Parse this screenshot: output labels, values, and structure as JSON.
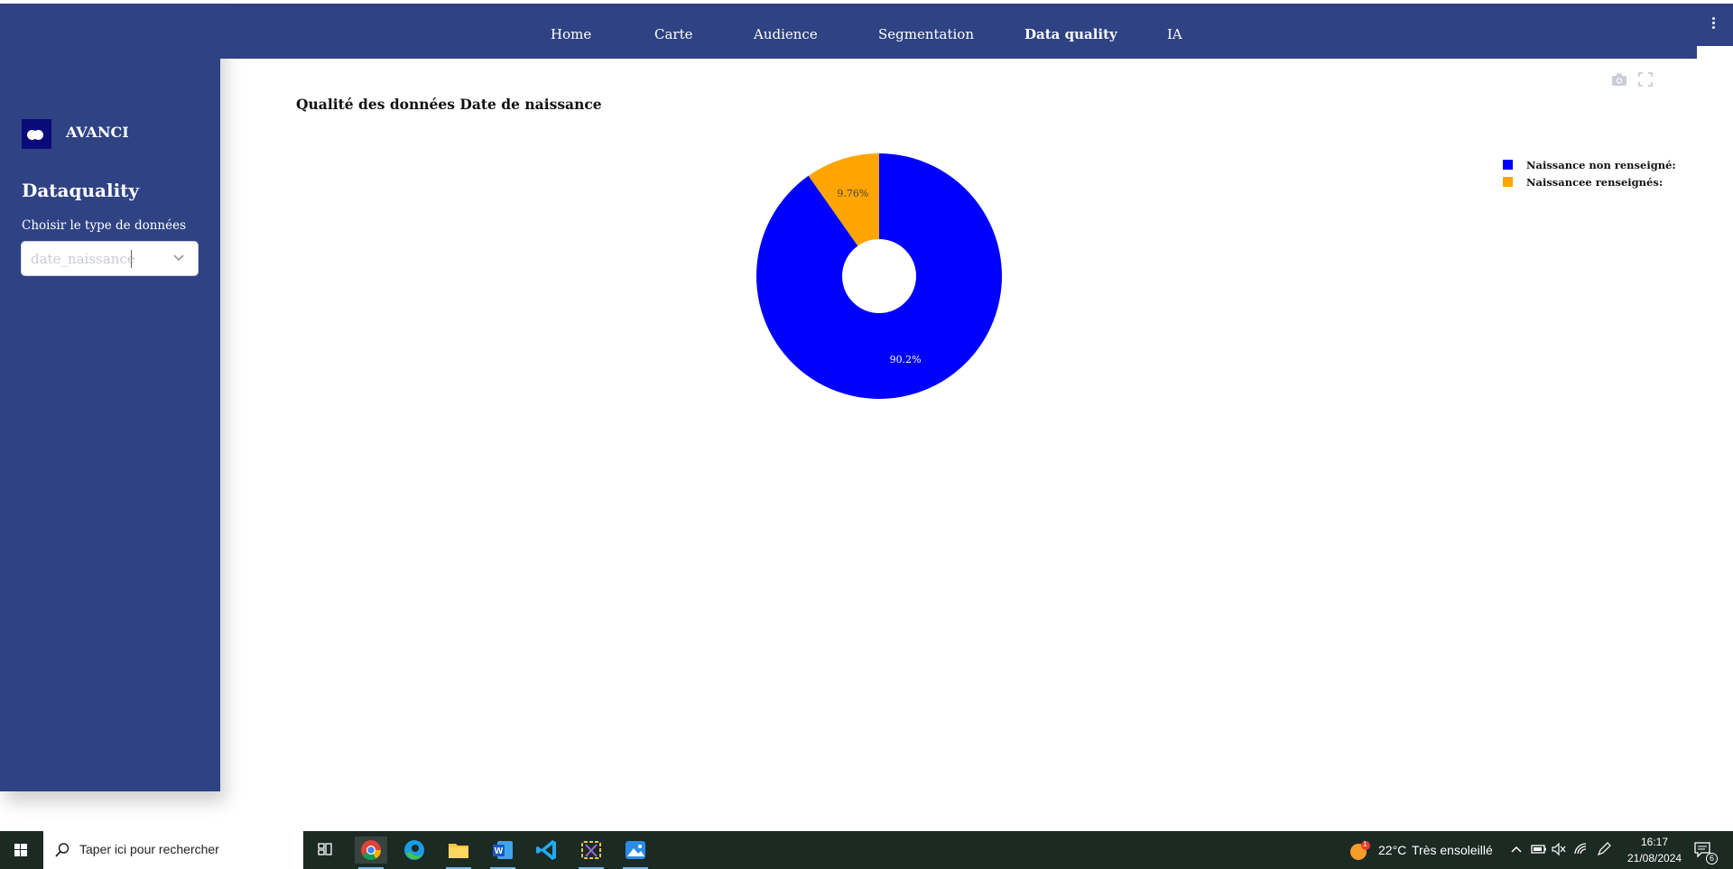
{
  "nav": {
    "items": [
      {
        "label": "Home",
        "active": false
      },
      {
        "label": "Carte",
        "active": false
      },
      {
        "label": "Audience",
        "active": false
      },
      {
        "label": "Segmentation",
        "active": false
      },
      {
        "label": "Data quality",
        "active": true
      },
      {
        "label": "IA",
        "active": false
      }
    ],
    "menu_icon": "kebab-menu-icon"
  },
  "sidebar": {
    "brand": "AVANCI",
    "title": "Dataquality",
    "select_label": "Choisir le type de données",
    "select_value": "date_naissance"
  },
  "chart_toolbar": {
    "icons": [
      "camera-icon",
      "fullscreen-icon"
    ]
  },
  "chart_data": {
    "type": "pie",
    "title": "Qualité des données Date de naissance",
    "hole": true,
    "slices": [
      {
        "label": "Naissance non  renseigné:",
        "value": 90.2,
        "text": "90.2%",
        "color": "#0000ff"
      },
      {
        "label": "Naissancee  renseignés:",
        "value": 9.76,
        "text": "9.76%",
        "color": "#ffa500"
      }
    ],
    "legend_position": "top-right"
  },
  "taskbar": {
    "search_placeholder": "Taper ici pour rechercher",
    "weather_temp": "22°C",
    "weather_text": "Très ensoleillé",
    "weather_badge": "1",
    "time": "16:17",
    "date": "21/08/2024",
    "notification_count": "6",
    "apps": [
      "task-view-icon",
      "chrome-icon",
      "edge-icon",
      "file-explorer-icon",
      "word-icon",
      "vscode-icon",
      "snipping-tool-icon",
      "photos-icon"
    ]
  }
}
